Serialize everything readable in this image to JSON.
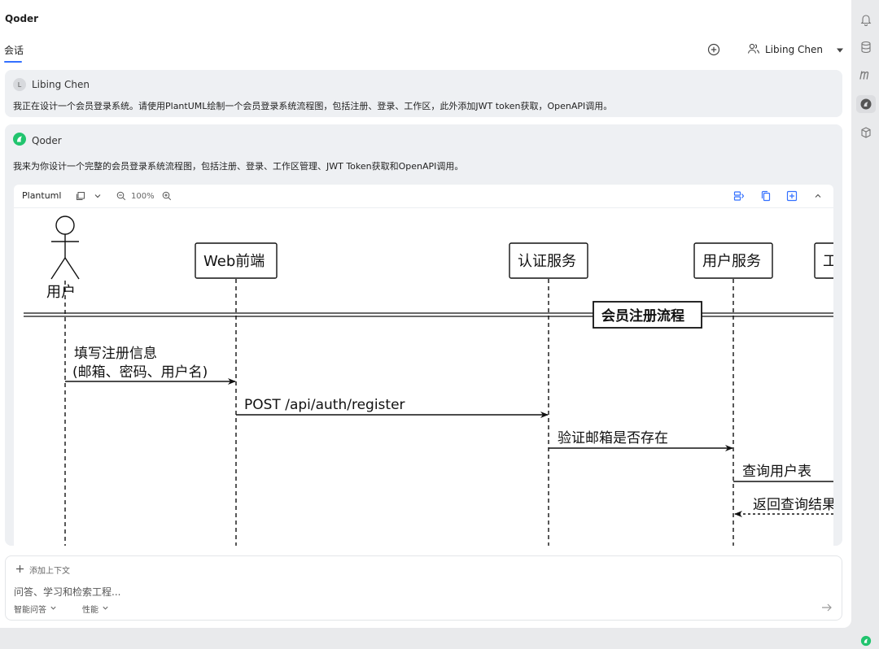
{
  "app": {
    "title": "Qoder"
  },
  "tabs": [
    {
      "label": "会话",
      "active": true
    }
  ],
  "header": {
    "user_name": "Libing Chen",
    "add_icon": "plus-circle-icon"
  },
  "messages": {
    "user": {
      "avatar_letter": "L",
      "author": "Libing Chen",
      "text": "我正在设计一个会员登录系统。请使用PlantUML绘制一个会员登录系统流程图，包括注册、登录、工作区，此外添加JWT token获取，OpenAPI调用。"
    },
    "bot": {
      "author": "Qoder",
      "text": "我来为你设计一个完整的会员登录系统流程图，包括注册、登录、工作区管理、JWT Token获取和OpenAPI调用。"
    }
  },
  "diagram_panel": {
    "title": "Plantuml",
    "zoom": "100%",
    "participants": [
      "用户",
      "Web前端",
      "认证服务",
      "用户服务",
      "工"
    ],
    "section": "会员注册流程",
    "arrows": [
      {
        "line1": "填写注册信息",
        "line2": "(邮箱、密码、用户名)"
      },
      {
        "label": "POST /api/auth/register"
      },
      {
        "label": "验证邮箱是否存在"
      },
      {
        "label": "查询用户表"
      },
      {
        "label": "返回查询结果"
      }
    ]
  },
  "composer": {
    "add_context": "添加上下文",
    "placeholder": "问答、学习和检索工程...",
    "mode": "智能问答",
    "model": "性能"
  },
  "colors": {
    "accent": "#3370ff",
    "brand_green": "#21c46e",
    "bubble_bg": "#eef0f3"
  }
}
